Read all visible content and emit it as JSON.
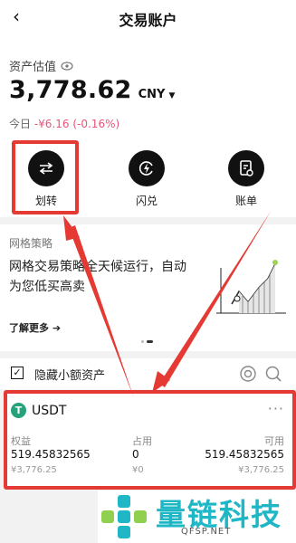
{
  "header": {
    "back_icon": "‹",
    "title": "交易账户"
  },
  "asset": {
    "label": "资产估值",
    "value": "3,778.62",
    "currency": "CNY",
    "today_label": "今日",
    "today_change": "-¥6.16 (-0.16%)"
  },
  "actions": [
    {
      "label": "划转",
      "icon": "transfer-icon"
    },
    {
      "label": "闪兑",
      "icon": "flash-swap-icon"
    },
    {
      "label": "账单",
      "icon": "bill-icon"
    }
  ],
  "grid": {
    "title": "网格策略",
    "description": "网格交易策略全天候运行，自动为您低买高卖",
    "more": "了解更多 ➔"
  },
  "hide_small": {
    "check": "✓",
    "label": "隐藏小额资产"
  },
  "usdt": {
    "coin_symbol": "T",
    "name": "USDT",
    "more": "···",
    "col1": {
      "header": "权益",
      "value": "519.45832565",
      "sub": "¥3,776.25"
    },
    "col2": {
      "header": "占用",
      "value": "0",
      "sub": "¥0"
    },
    "col3": {
      "header": "可用",
      "value": "519.45832565",
      "sub": "¥3,776.25"
    }
  },
  "watermark": {
    "text": "量链科技",
    "url": "QFSP.NET"
  },
  "colors": {
    "highlight": "#e53934",
    "negative": "#e8557a",
    "tether": "#26a17b",
    "watermark": "#1fb7c6"
  }
}
